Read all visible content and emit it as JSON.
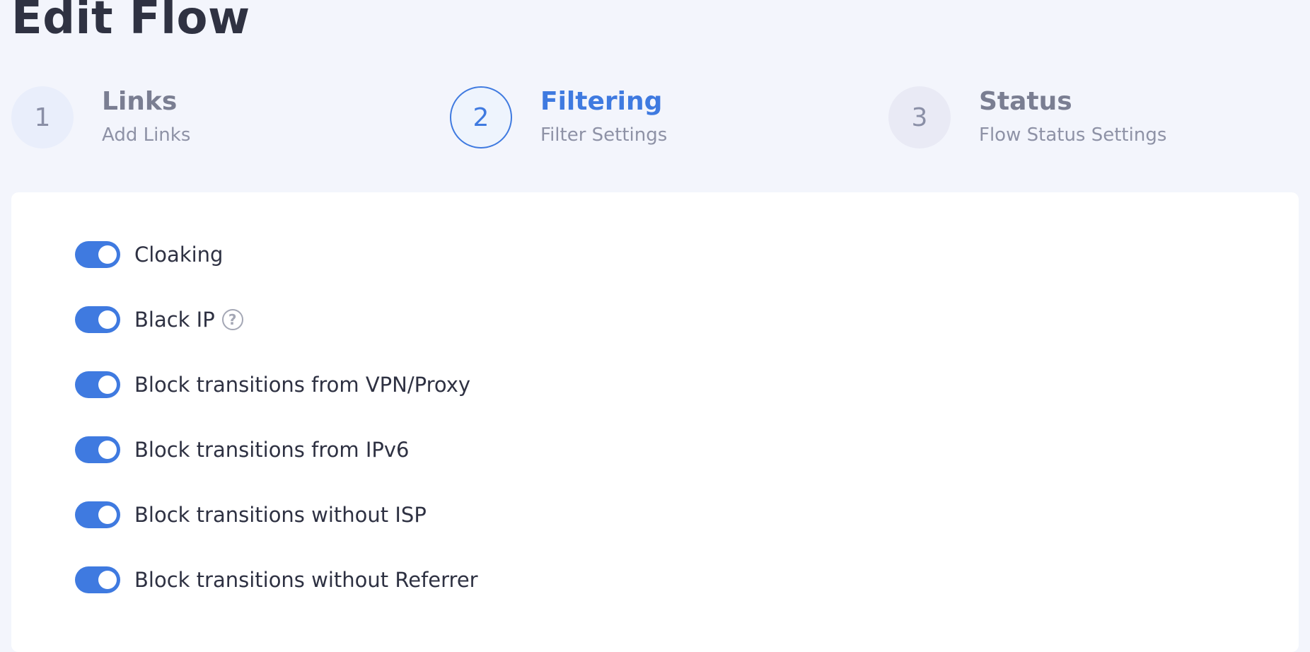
{
  "page": {
    "title": "Edit Flow"
  },
  "stepper": {
    "steps": [
      {
        "number": "1",
        "title": "Links",
        "subtitle": "Add Links",
        "state": "done"
      },
      {
        "number": "2",
        "title": "Filtering",
        "subtitle": "Filter Settings",
        "state": "active"
      },
      {
        "number": "3",
        "title": "Status",
        "subtitle": "Flow Status Settings",
        "state": "pending"
      }
    ]
  },
  "filters": {
    "items": [
      {
        "label": "Cloaking",
        "enabled": true
      },
      {
        "label": "Black IP",
        "enabled": true,
        "icon": "question-circle-icon",
        "icon_glyph": "?"
      },
      {
        "label": "Block transitions from VPN/Proxy",
        "enabled": true
      },
      {
        "label": "Block transitions from IPv6",
        "enabled": true
      },
      {
        "label": "Block transitions without ISP",
        "enabled": true
      },
      {
        "label": "Block transitions without Referrer",
        "enabled": true
      }
    ]
  },
  "colors": {
    "accent": "#3f7ae0",
    "background": "#f3f5fc",
    "card": "#ffffff",
    "text": "#2e3142",
    "muted": "#8e92a6"
  }
}
